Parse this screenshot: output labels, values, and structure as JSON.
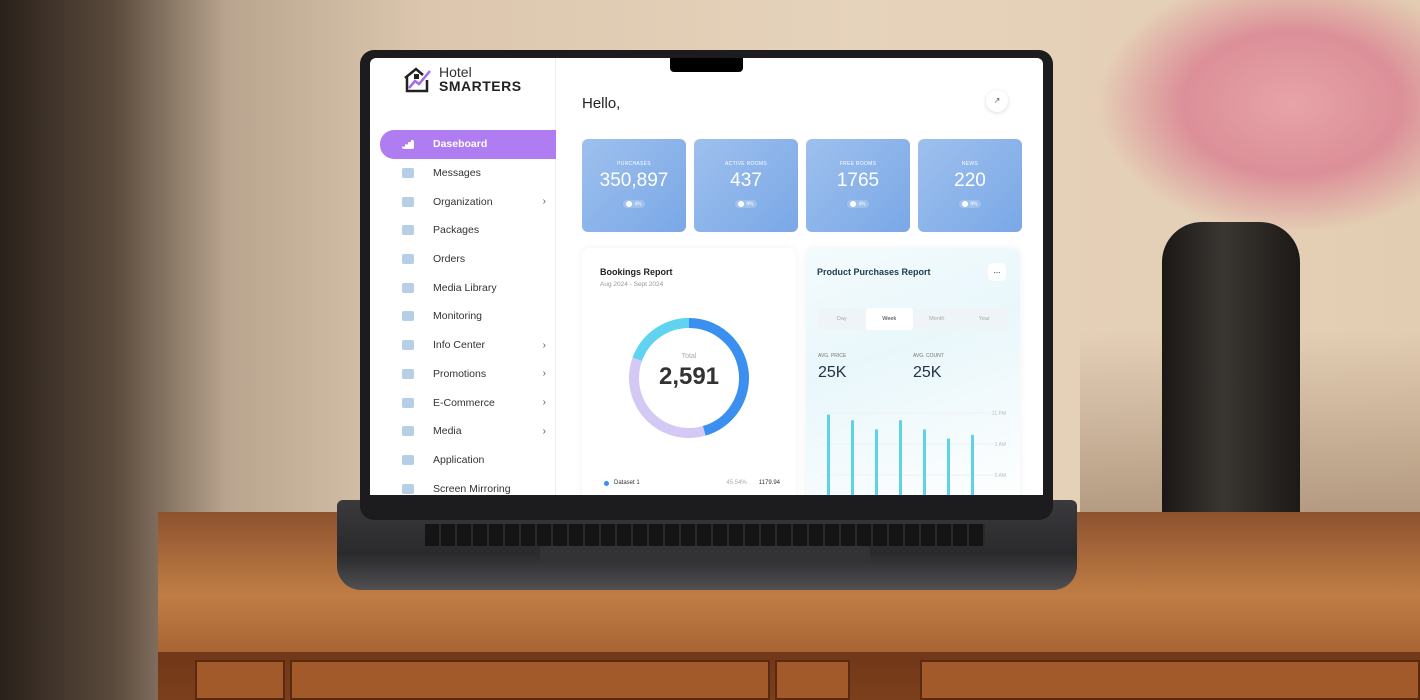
{
  "app": {
    "logo_line1": "Hotel",
    "logo_line2": "SMARTERS"
  },
  "sidebar": {
    "items": [
      {
        "label": "Daseboard",
        "icon": "bar-chart-icon",
        "active": true
      },
      {
        "label": "Messages",
        "icon": "mail-icon"
      },
      {
        "label": "Organization",
        "icon": "building-icon",
        "chevron": true
      },
      {
        "label": "Packages",
        "icon": "package-icon"
      },
      {
        "label": "Orders",
        "icon": "clipboard-icon"
      },
      {
        "label": "Media Library",
        "icon": "image-folder-icon"
      },
      {
        "label": "Monitoring",
        "icon": "trend-chart-icon"
      },
      {
        "label": "Info Center",
        "icon": "info-icon",
        "chevron": true
      },
      {
        "label": "Promotions",
        "icon": "list-icon",
        "chevron": true
      },
      {
        "label": "E-Commerce",
        "icon": "tag-icon",
        "chevron": true
      },
      {
        "label": "Media",
        "icon": "folder-icon",
        "chevron": true
      },
      {
        "label": "Application",
        "icon": "puzzle-icon"
      },
      {
        "label": "Screen Mirroring",
        "icon": "mirror-icon"
      }
    ]
  },
  "header": {
    "greeting": "Hello,",
    "expand_icon": "↗"
  },
  "stats": [
    {
      "label": "PURCHASES",
      "value": "350,897",
      "change": "4%"
    },
    {
      "label": "ACTIVE ROOMS",
      "value": "437",
      "change": "9%"
    },
    {
      "label": "FREE ROOMS",
      "value": "1765",
      "change": "4%"
    },
    {
      "label": "NEWS",
      "value": "220",
      "change": "9%"
    }
  ],
  "bookings": {
    "title": "Bookings Report",
    "subtitle": "Aug 2024 - Sept 2024",
    "total_label": "Total",
    "total": "2,591",
    "legend": {
      "name": "Dataset 1",
      "percent": "45.54%",
      "value": "1179.94"
    }
  },
  "purchases": {
    "title": "Product Purchases Report",
    "more": "...",
    "tabs": [
      "Day",
      "Week",
      "Month",
      "Year"
    ],
    "active_tab": "Week",
    "avg_price_label": "AVG. PRICE",
    "avg_price": "25K",
    "avg_count_label": "AVG. COUNT",
    "avg_count": "25K"
  },
  "chart_data": [
    {
      "type": "pie",
      "values": [
        45.54,
        35,
        19.46
      ],
      "colors": [
        "#3b8ff0",
        "#d4c9f5",
        "#5fd3ef"
      ]
    },
    {
      "type": "bar",
      "y_tick_labels": [
        "11 PM",
        "1 AM",
        "5 AM"
      ],
      "values": [
        0.96,
        0.9,
        0.8,
        0.9,
        0.8,
        0.7,
        0.74
      ],
      "color": "#5fd3e6"
    }
  ]
}
